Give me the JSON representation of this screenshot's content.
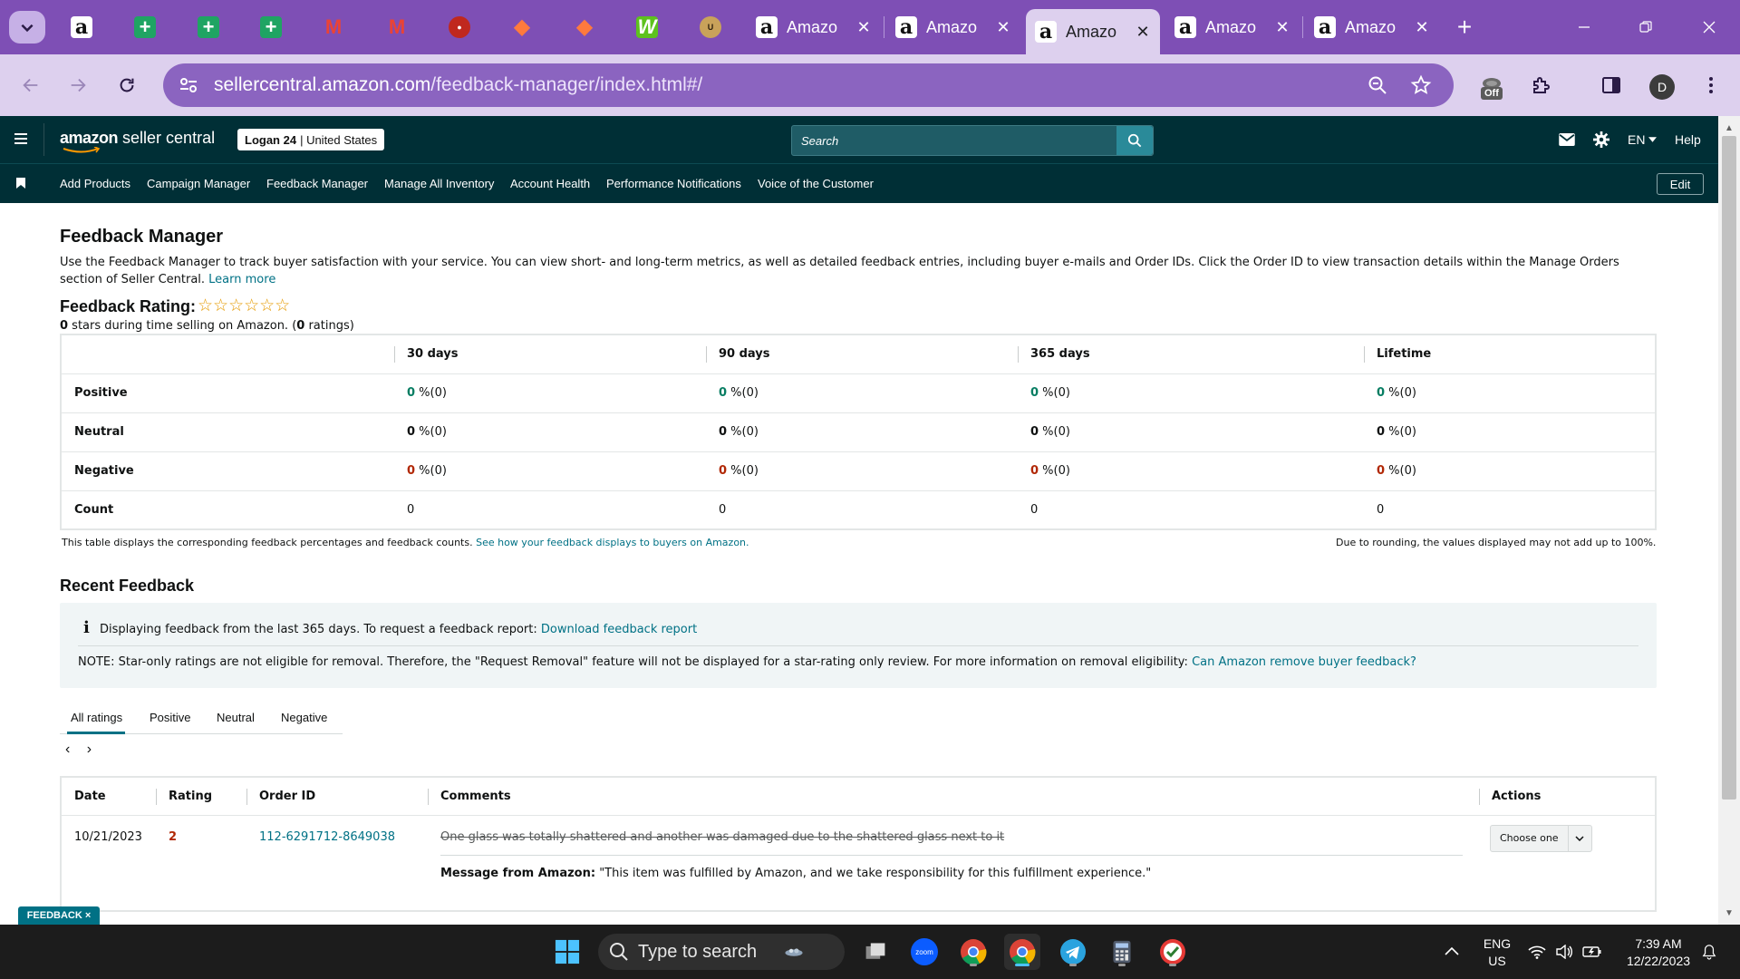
{
  "browser": {
    "pinned_tabs": [
      {
        "icon": "amazon-icon",
        "glyph": "a"
      },
      {
        "icon": "sheets-icon",
        "glyph": "+"
      },
      {
        "icon": "sheets-icon",
        "glyph": "+"
      },
      {
        "icon": "sheets-icon",
        "glyph": "+"
      },
      {
        "icon": "gmail-icon",
        "glyph": "M"
      },
      {
        "icon": "gmail-icon",
        "glyph": "M"
      },
      {
        "icon": "red-logo-icon",
        "glyph": "●"
      },
      {
        "icon": "asana-icon",
        "glyph": "◆"
      },
      {
        "icon": "asana-icon",
        "glyph": "◆"
      },
      {
        "icon": "w-app-icon",
        "glyph": "W"
      },
      {
        "icon": "uline-icon",
        "glyph": "U"
      }
    ],
    "tabs": [
      {
        "label": "Amazo",
        "active": false
      },
      {
        "label": "Amazo",
        "active": false
      },
      {
        "label": "Amazo",
        "active": true
      },
      {
        "label": "Amazo",
        "active": false
      },
      {
        "label": "Amazo",
        "active": false
      }
    ],
    "new_tab_glyph": "+",
    "url_host": "sellercentral.amazon.com",
    "url_path": "/feedback-manager/index.html#/",
    "extension_badge": "Off",
    "profile_initial": "D"
  },
  "header": {
    "logo_brand": "amazon",
    "logo_product": " seller central",
    "account_name": "Logan 24",
    "account_region": "| United States",
    "search_placeholder": "Search",
    "language": "EN",
    "help": "Help"
  },
  "nav": {
    "items": [
      "Add Products",
      "Campaign Manager",
      "Feedback Manager",
      "Manage All Inventory",
      "Account Health",
      "Performance Notifications",
      "Voice of the Customer"
    ],
    "edit_label": "Edit"
  },
  "page": {
    "title": "Feedback Manager",
    "intro": "Use the Feedback Manager to track buyer satisfaction with your service. You can view short- and long-term metrics, as well as detailed feedback entries, including buyer e-mails and Order IDs. Click the Order ID to view transaction details within the Manage Orders section of Seller Central.",
    "intro_link": "Learn more",
    "rating_title": "Feedback Rating:",
    "rating_stars": "☆☆☆☆☆☆",
    "rating_stars_value": 0,
    "rating_sub_bold1": "0",
    "rating_sub_text1": " stars during time selling on Amazon. (",
    "rating_sub_bold2": "0",
    "rating_sub_text2": " ratings)"
  },
  "metrics_table": {
    "columns": [
      "",
      "30 days",
      "90 days",
      "365 days",
      "Lifetime"
    ],
    "rows": [
      {
        "label": "Positive",
        "kind": "pos",
        "cells": [
          {
            "num": "0",
            "rest": " %(0)"
          },
          {
            "num": "0",
            "rest": " %(0)"
          },
          {
            "num": "0",
            "rest": " %(0)"
          },
          {
            "num": "0",
            "rest": " %(0)"
          }
        ]
      },
      {
        "label": "Neutral",
        "kind": "neu",
        "cells": [
          {
            "num": "0",
            "rest": " %(0)"
          },
          {
            "num": "0",
            "rest": " %(0)"
          },
          {
            "num": "0",
            "rest": " %(0)"
          },
          {
            "num": "0",
            "rest": " %(0)"
          }
        ]
      },
      {
        "label": "Negative",
        "kind": "neg",
        "cells": [
          {
            "num": "0",
            "rest": " %(0)"
          },
          {
            "num": "0",
            "rest": " %(0)"
          },
          {
            "num": "0",
            "rest": " %(0)"
          },
          {
            "num": "0",
            "rest": " %(0)"
          }
        ]
      },
      {
        "label": "Count",
        "kind": "count",
        "cells": [
          {
            "num": "",
            "rest": "0"
          },
          {
            "num": "",
            "rest": "0"
          },
          {
            "num": "",
            "rest": "0"
          },
          {
            "num": "",
            "rest": "0"
          }
        ]
      }
    ],
    "note": "This table displays the corresponding feedback percentages and feedback counts.",
    "note_link": "See how your feedback displays to buyers on Amazon.",
    "note_right": "Due to rounding, the values displayed may not add up to 100%."
  },
  "recent": {
    "title": "Recent Feedback",
    "info_icon": "i",
    "info_text": "Displaying feedback from the last 365 days. To request a feedback report:",
    "info_link": "Download feedback report",
    "note_text": "NOTE: Star-only ratings are not eligible for removal. Therefore, the \"Request Removal\" feature will not be displayed for a star-rating only review. For more information on removal eligibility:",
    "note_link": "Can Amazon remove buyer feedback?",
    "tabs": [
      "All ratings",
      "Positive",
      "Neutral",
      "Negative"
    ],
    "pager_prev": "‹",
    "pager_next": "›",
    "columns": [
      "Date",
      "Rating",
      "Order ID",
      "Comments",
      "Actions"
    ],
    "rows": [
      {
        "date": "10/21/2023",
        "rating": "2",
        "order_id": "112-6291712-8649038",
        "comment": "One glass was totally shattered and another was damaged due to the shattered glass next to it",
        "message_label": "Message from Amazon:",
        "message": " \"This item was fulfilled by Amazon, and we take responsibility for this fulfillment experience.\"",
        "action": "Choose one"
      }
    ]
  },
  "feedback_tab": "FEEDBACK ×",
  "taskbar": {
    "search_placeholder": "Type to search",
    "lang_top": "ENG",
    "lang_bottom": "US",
    "time": "7:39 AM",
    "date": "12/22/2023",
    "zoom_label": "zoom"
  },
  "colors": {
    "browser_frame": "#7e4fb5",
    "seller_header": "#002f36",
    "positive": "#067d62",
    "negative": "#b12704",
    "link": "#007185"
  }
}
